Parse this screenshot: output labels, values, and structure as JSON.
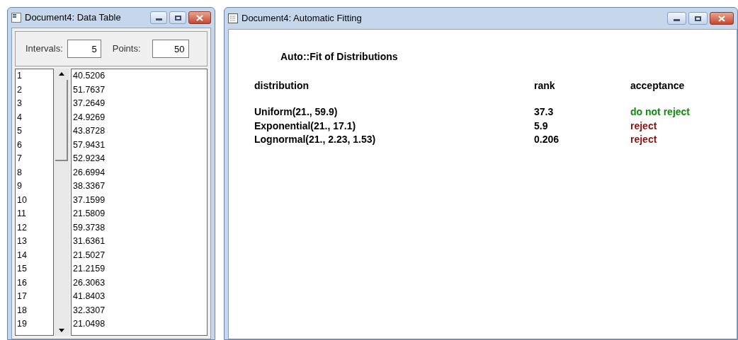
{
  "data_window": {
    "title": "Document4: Data Table",
    "intervals_label": "Intervals:",
    "intervals_value": "5",
    "points_label": "Points:",
    "points_value": "50",
    "rows": [
      {
        "index": "1",
        "value": "40.5206"
      },
      {
        "index": "2",
        "value": "51.7637"
      },
      {
        "index": "3",
        "value": "37.2649"
      },
      {
        "index": "4",
        "value": "24.9269"
      },
      {
        "index": "5",
        "value": "43.8728"
      },
      {
        "index": "6",
        "value": "57.9431"
      },
      {
        "index": "7",
        "value": "52.9234"
      },
      {
        "index": "8",
        "value": "26.6994"
      },
      {
        "index": "9",
        "value": "38.3367"
      },
      {
        "index": "10",
        "value": "37.1599"
      },
      {
        "index": "11",
        "value": "21.5809"
      },
      {
        "index": "12",
        "value": "59.3738"
      },
      {
        "index": "13",
        "value": "31.6361"
      },
      {
        "index": "14",
        "value": "21.5027"
      },
      {
        "index": "15",
        "value": "21.2159"
      },
      {
        "index": "16",
        "value": "26.3063"
      },
      {
        "index": "17",
        "value": "41.8403"
      },
      {
        "index": "18",
        "value": "32.3307"
      },
      {
        "index": "19",
        "value": "21.0498"
      }
    ]
  },
  "fit_window": {
    "title": "Document4: Automatic Fitting",
    "heading": "Auto::Fit of Distributions",
    "columns": [
      "distribution",
      "rank",
      "acceptance"
    ],
    "rows": [
      {
        "distribution": "Uniform(21., 59.9)",
        "rank": "37.3",
        "acceptance": "do not reject",
        "color": "#138a13"
      },
      {
        "distribution": "Exponential(21., 17.1)",
        "rank": "5.9",
        "acceptance": "reject",
        "color": "#8b1010"
      },
      {
        "distribution": "Lognormal(21., 2.23, 1.53)",
        "rank": "0.206",
        "acceptance": "reject",
        "color": "#8b1010"
      }
    ]
  }
}
